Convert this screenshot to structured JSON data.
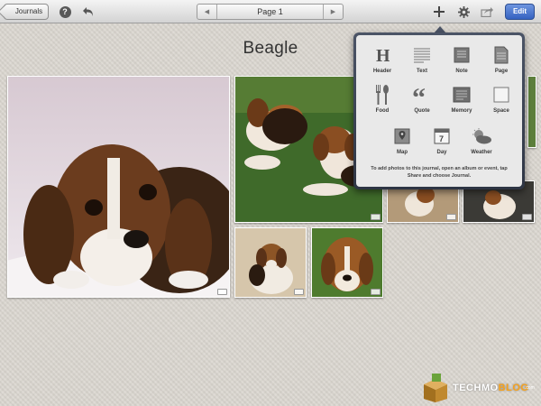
{
  "toolbar": {
    "back_label": "Journals",
    "help_icon": "question-circle-icon",
    "undo_icon": "undo-icon",
    "page_label": "Page 1",
    "prev_icon": "triangle-left-icon",
    "next_icon": "triangle-right-icon",
    "add_icon": "plus-icon",
    "settings_icon": "gear-icon",
    "share_icon": "share-icon",
    "edit_label": "Edit",
    "edit_color": "#3a66c6"
  },
  "journal": {
    "title": "Beagle"
  },
  "insert_menu": {
    "items": [
      {
        "label": "Header",
        "icon": "header-icon"
      },
      {
        "label": "Text",
        "icon": "text-icon"
      },
      {
        "label": "Note",
        "icon": "note-icon"
      },
      {
        "label": "Page",
        "icon": "page-icon"
      },
      {
        "label": "Food",
        "icon": "food-icon"
      },
      {
        "label": "Quote",
        "icon": "quote-icon"
      },
      {
        "label": "Memory",
        "icon": "memory-icon"
      },
      {
        "label": "Space",
        "icon": "space-icon"
      },
      {
        "label": "Map",
        "icon": "map-icon"
      },
      {
        "label": "Day",
        "icon": "calendar-icon"
      },
      {
        "label": "Weather",
        "icon": "weather-icon"
      }
    ],
    "hint": "To add photos to this journal, open an album or event, tap Share and choose Journal."
  },
  "watermark": {
    "brand_part1": "TECHMO",
    "brand_part2": "BLOG",
    "suffix": ".com"
  }
}
